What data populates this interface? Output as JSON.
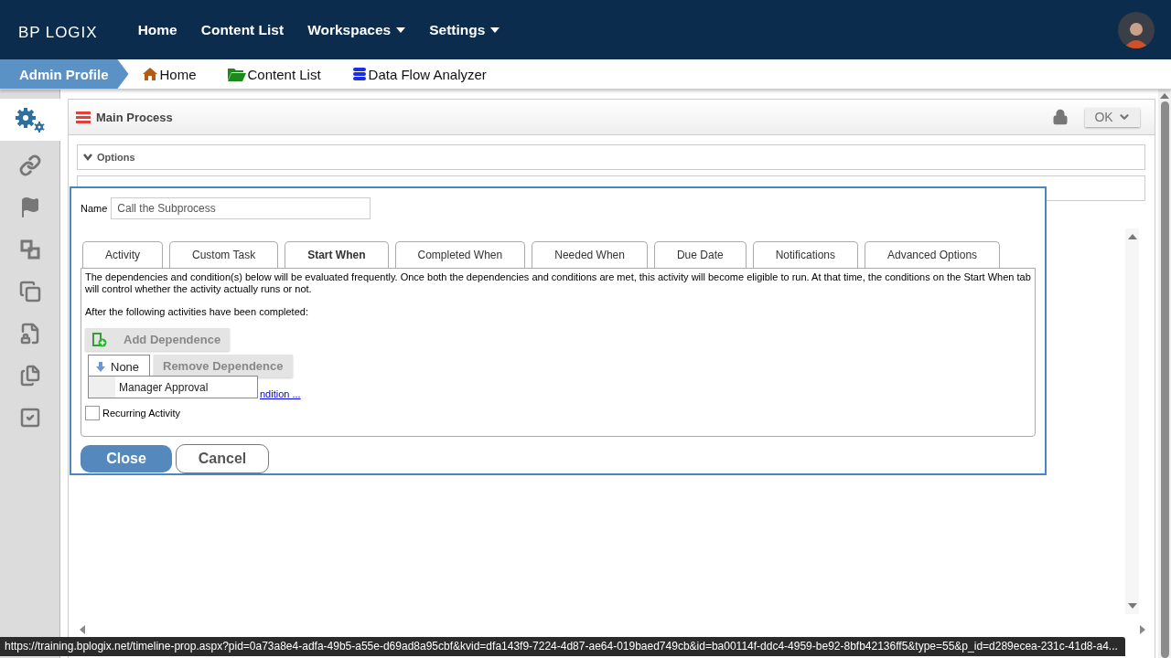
{
  "top_nav": {
    "logo": {
      "left": "BP",
      "right": "LOGIX"
    },
    "items": [
      {
        "label": "Home",
        "dropdown": false
      },
      {
        "label": "Content List",
        "dropdown": false
      },
      {
        "label": "Workspaces",
        "dropdown": true
      },
      {
        "label": "Settings",
        "dropdown": true
      }
    ]
  },
  "breadcrumb": {
    "profile": "Admin Profile",
    "links": [
      {
        "label": "Home",
        "kind": "home"
      },
      {
        "label": "Content List",
        "kind": "folder"
      },
      {
        "label": "Data Flow Analyzer",
        "kind": "database"
      }
    ]
  },
  "sidebar": {
    "items": [
      {
        "kind": "gears",
        "selected": true
      },
      {
        "kind": "link",
        "selected": false
      },
      {
        "kind": "flag",
        "selected": false
      },
      {
        "kind": "squares",
        "selected": false
      },
      {
        "kind": "overlap",
        "selected": false
      },
      {
        "kind": "filelock",
        "selected": false
      },
      {
        "kind": "pages",
        "selected": false
      },
      {
        "kind": "check",
        "selected": false
      }
    ]
  },
  "panel": {
    "title": "Main Process",
    "ok_button": "OK",
    "sections": [
      {
        "label": "Options",
        "expanded": true
      }
    ]
  },
  "dialog": {
    "name_label": "Name",
    "name_value": "Call the Subprocess",
    "tabs": [
      {
        "label": "Activity",
        "selected": false
      },
      {
        "label": "Custom Task",
        "selected": false
      },
      {
        "label": "Start When",
        "selected": true
      },
      {
        "label": "Completed When",
        "selected": false
      },
      {
        "label": "Needed When",
        "selected": false
      },
      {
        "label": "Due Date",
        "selected": false
      },
      {
        "label": "Notifications",
        "selected": false
      },
      {
        "label": "Advanced Options",
        "selected": false
      }
    ],
    "description": "The dependencies and condition(s) below will be evaluated frequently. Once both the dependencies and conditions are met, this activity will become eligible to run. At that time, the conditions on the Start When tab will control whether the activity actually runs or not.",
    "after_label": "After the following activities have been completed:",
    "add_button": "Add Dependence",
    "dropdown": {
      "value": "None",
      "options": [
        "Manager Approval"
      ]
    },
    "remove_button": "Remove Dependence",
    "link": "ndition ...",
    "recurring": {
      "label": "Recurring Activity",
      "checked": false
    },
    "close_button": "Close",
    "cancel_button": "Cancel"
  },
  "status_url": "https://training.bplogix.net/timeline-prop.aspx?pid=0a73a8e4-adfa-49b5-a55e-d69ad8a95cbf&kvid=dfa143f9-7224-4d87-ae64-019baed749cb&id=ba00114f-ddc4-4959-be92-8bfb42136ff5&type=55&p_id=d289ecea-231c-41d8-a4..."
}
